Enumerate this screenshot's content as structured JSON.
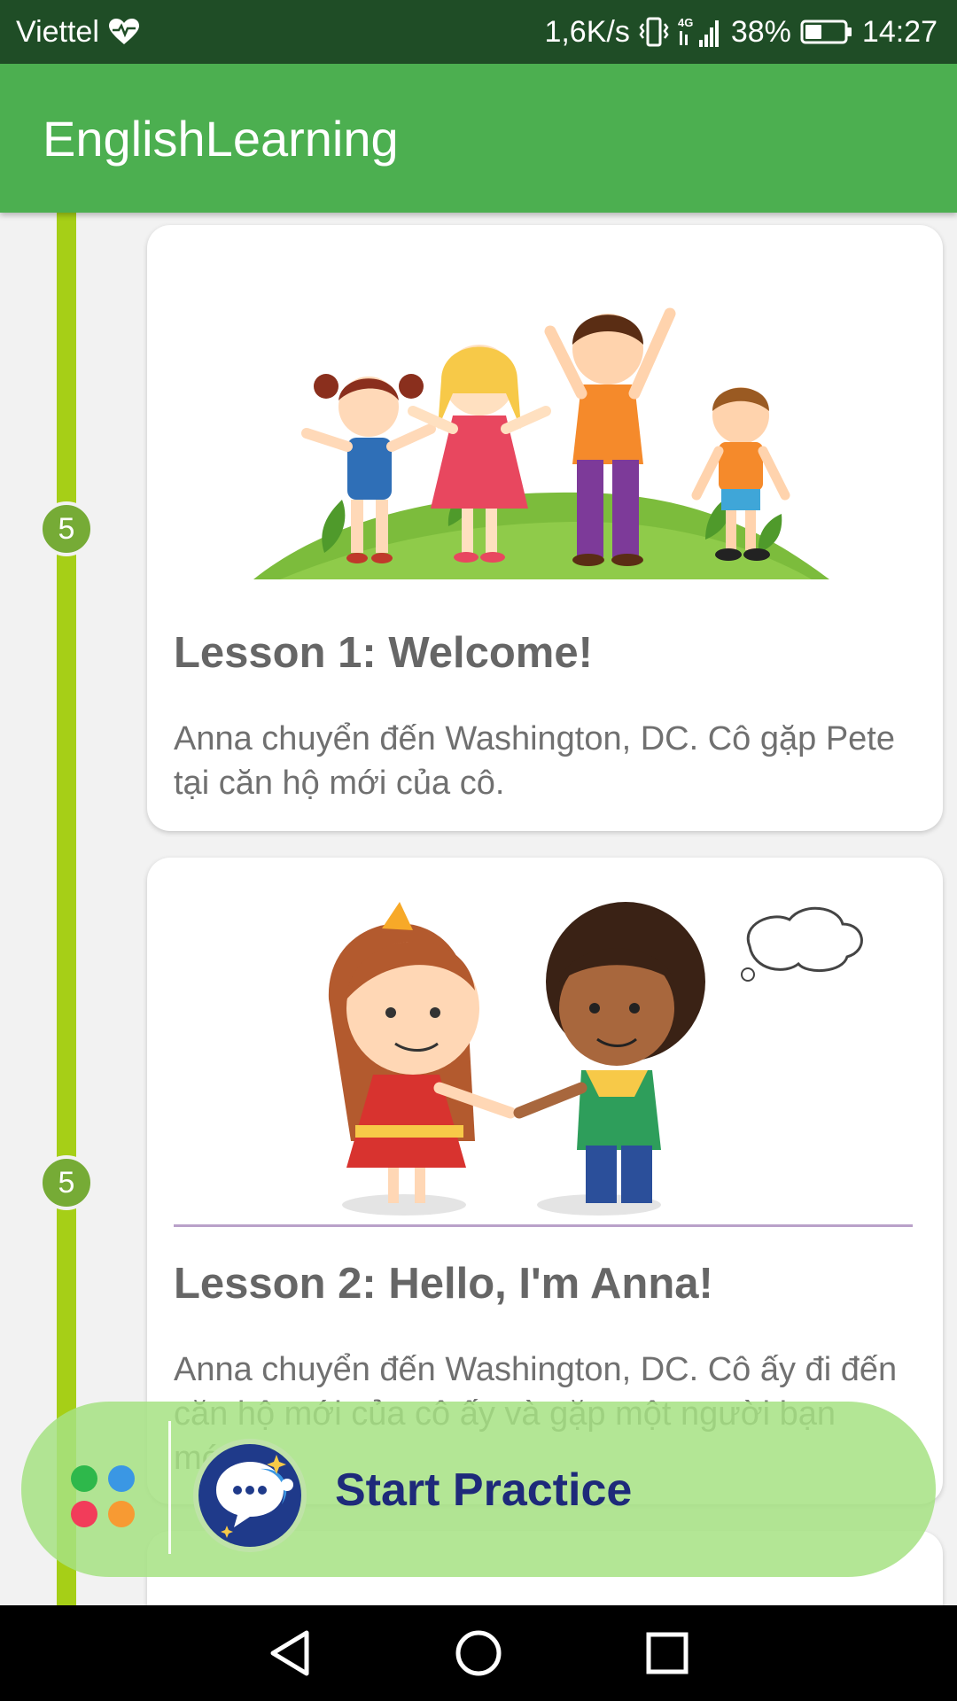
{
  "status_bar": {
    "carrier": "Viettel",
    "network_speed": "1,6K/s",
    "network_type": "4G",
    "battery": "38%",
    "time": "14:27"
  },
  "app_bar": {
    "title": "EnglishLearning"
  },
  "lessons": [
    {
      "badge": "5",
      "title": "Lesson 1: Welcome!",
      "description": "Anna chuyển đến Washington, DC. Cô gặp Pete tại căn hộ mới của cô."
    },
    {
      "badge": "5",
      "title": "Lesson 2: Hello, I'm Anna!",
      "description": "Anna chuyển đến Washington, DC. Cô ấy đi đến căn hộ mới của cô ấy và gặp một người bạn mới."
    }
  ],
  "practice": {
    "label": "Start Practice"
  },
  "colors": {
    "app_bar": "#4caf50",
    "status_bar": "#1f4d26",
    "timeline": "#a6cf17",
    "badge": "#76ab36",
    "practice_bar": "#a6e282",
    "practice_text": "#1e2a7a"
  },
  "icons": {
    "status": [
      "heart-pulse-icon",
      "vibrate-icon",
      "signal-icon",
      "battery-icon"
    ],
    "nav": [
      "back-triangle-icon",
      "home-circle-icon",
      "recents-square-icon"
    ]
  }
}
